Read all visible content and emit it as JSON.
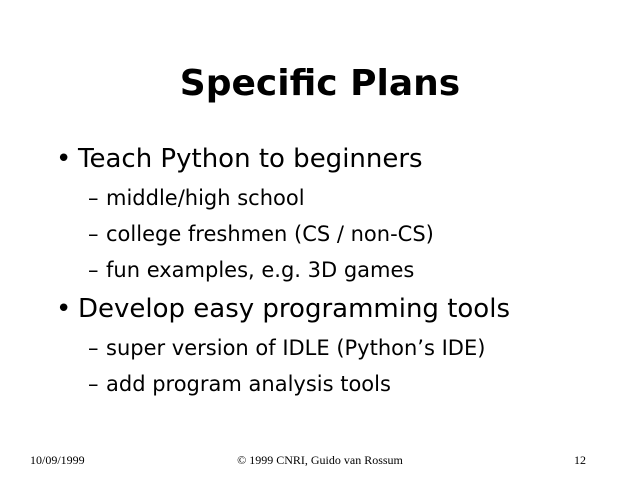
{
  "slide": {
    "title": "Specific Plans",
    "bullet_marker": "•",
    "sub_marker": "–",
    "bullets": [
      {
        "text": "Teach Python to beginners",
        "subs": [
          "middle/high school",
          "college freshmen (CS / non-CS)",
          "fun examples, e.g. 3D games"
        ]
      },
      {
        "text": "Develop easy programming tools",
        "subs": [
          "super version of IDLE (Python’s IDE)",
          "add program analysis tools"
        ]
      }
    ]
  },
  "footer": {
    "date": "10/09/1999",
    "copyright": "© 1999 CNRI, Guido van Rossum",
    "page_number": "12"
  }
}
